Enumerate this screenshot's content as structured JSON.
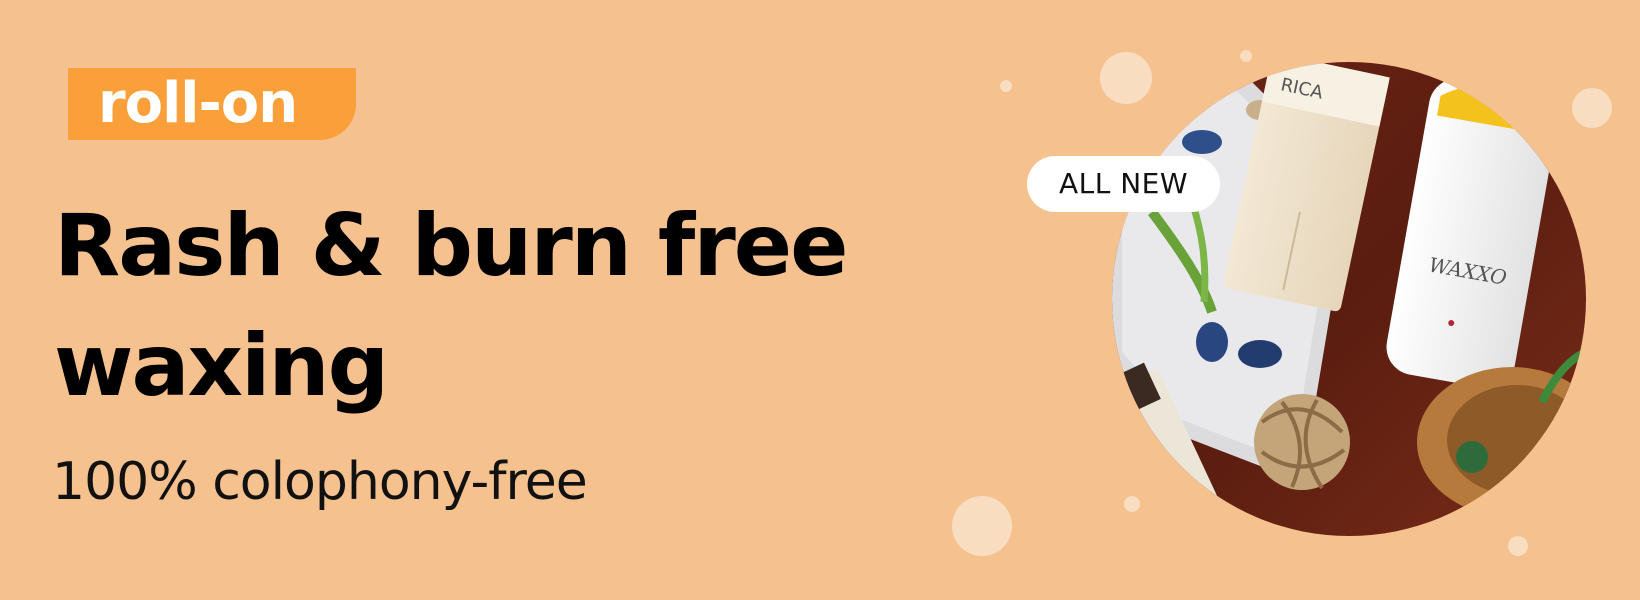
{
  "banner": {
    "tag_label": "roll-on",
    "headline_line1": "Rash & burn free",
    "headline_line2": "waxing",
    "subheadline": "100% colophony-free",
    "badge_label": "ALL NEW",
    "product_brand_1": "RICA",
    "product_brand_2": "WAXXO",
    "colors": {
      "background": "#f5c18f",
      "tag_background": "#fb9f3a",
      "headline_text": "#000000",
      "badge_background": "#ffffff"
    }
  }
}
